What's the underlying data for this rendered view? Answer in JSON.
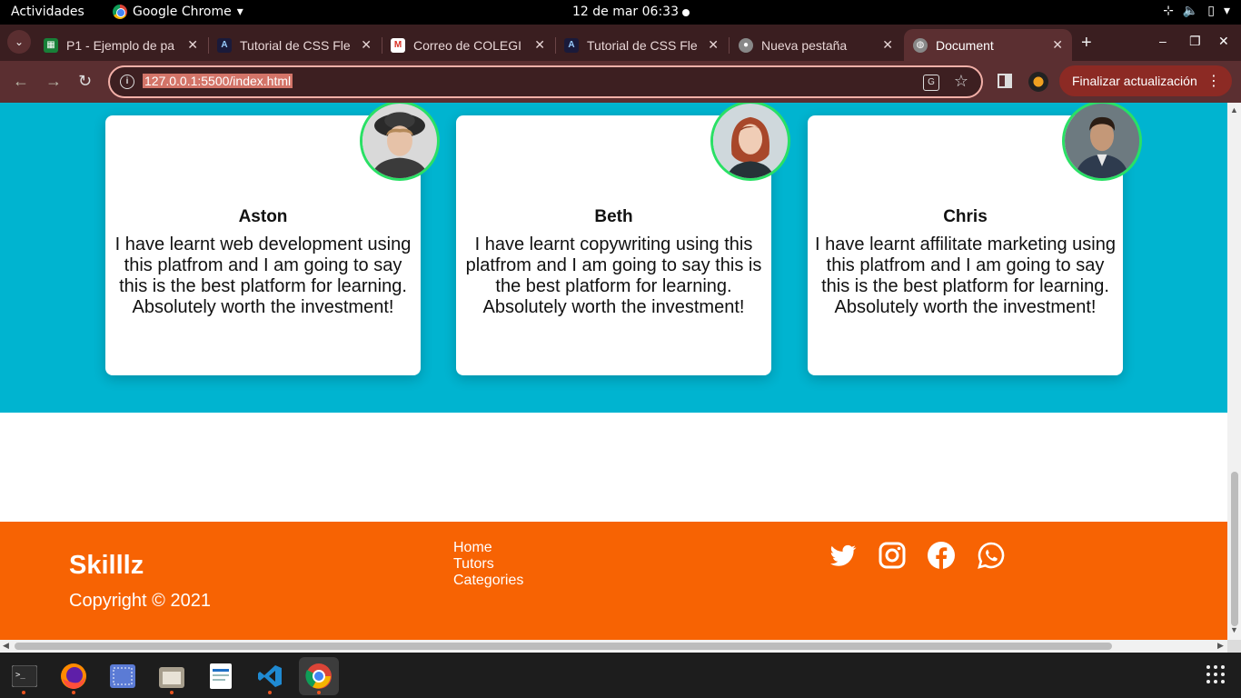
{
  "system_bar": {
    "activities": "Actividades",
    "app_name": "Google Chrome",
    "datetime": "12 de mar  06:33"
  },
  "tabs": [
    {
      "label": "P1 - Ejemplo de pa",
      "icon": "sheets-icon",
      "color": "#188038"
    },
    {
      "label": "Tutorial de CSS Fle",
      "icon": "tutorial-icon",
      "color": "#1a1a3a"
    },
    {
      "label": "Correo de COLEGI",
      "icon": "gmail-icon",
      "color": "#ffffff"
    },
    {
      "label": "Tutorial de CSS Fle",
      "icon": "tutorial-icon",
      "color": "#1a1a3a"
    },
    {
      "label": "Nueva pestaña",
      "icon": "chrome-icon",
      "color": "#888888"
    },
    {
      "label": "Document",
      "icon": "globe-icon",
      "color": "#888888",
      "active": true
    }
  ],
  "address_bar": {
    "url": "127.0.0.1:5500/index.html"
  },
  "update_button": "Finalizar actualización",
  "testimonials": [
    {
      "name": "Aston",
      "quote": "I have learnt web development using this platfrom and I am going to say this is the best platform for learning. Absolutely worth the investment!"
    },
    {
      "name": "Beth",
      "quote": "I have learnt copywriting using this platfrom and I am going to say this is the best platform for learning. Absolutely worth the investment!"
    },
    {
      "name": "Chris",
      "quote": "I have learnt affilitate marketing using this platfrom and I am going to say this is the best platform for learning. Absolutely worth the investment!"
    }
  ],
  "footer": {
    "brand": "Skilllz",
    "copyright": "Copyright © 2021",
    "links": [
      "Home",
      "Tutors",
      "Categories"
    ],
    "social": [
      "twitter-icon",
      "instagram-icon",
      "facebook-icon",
      "whatsapp-icon"
    ]
  },
  "colors": {
    "testimonial_bg": "#00b4d0",
    "footer_bg": "#f76303",
    "avatar_border": "#2ae065"
  },
  "dock": [
    "terminal-icon",
    "firefox-icon",
    "screenshot-icon",
    "files-icon",
    "text-editor-icon",
    "vscode-icon",
    "chrome-icon"
  ]
}
